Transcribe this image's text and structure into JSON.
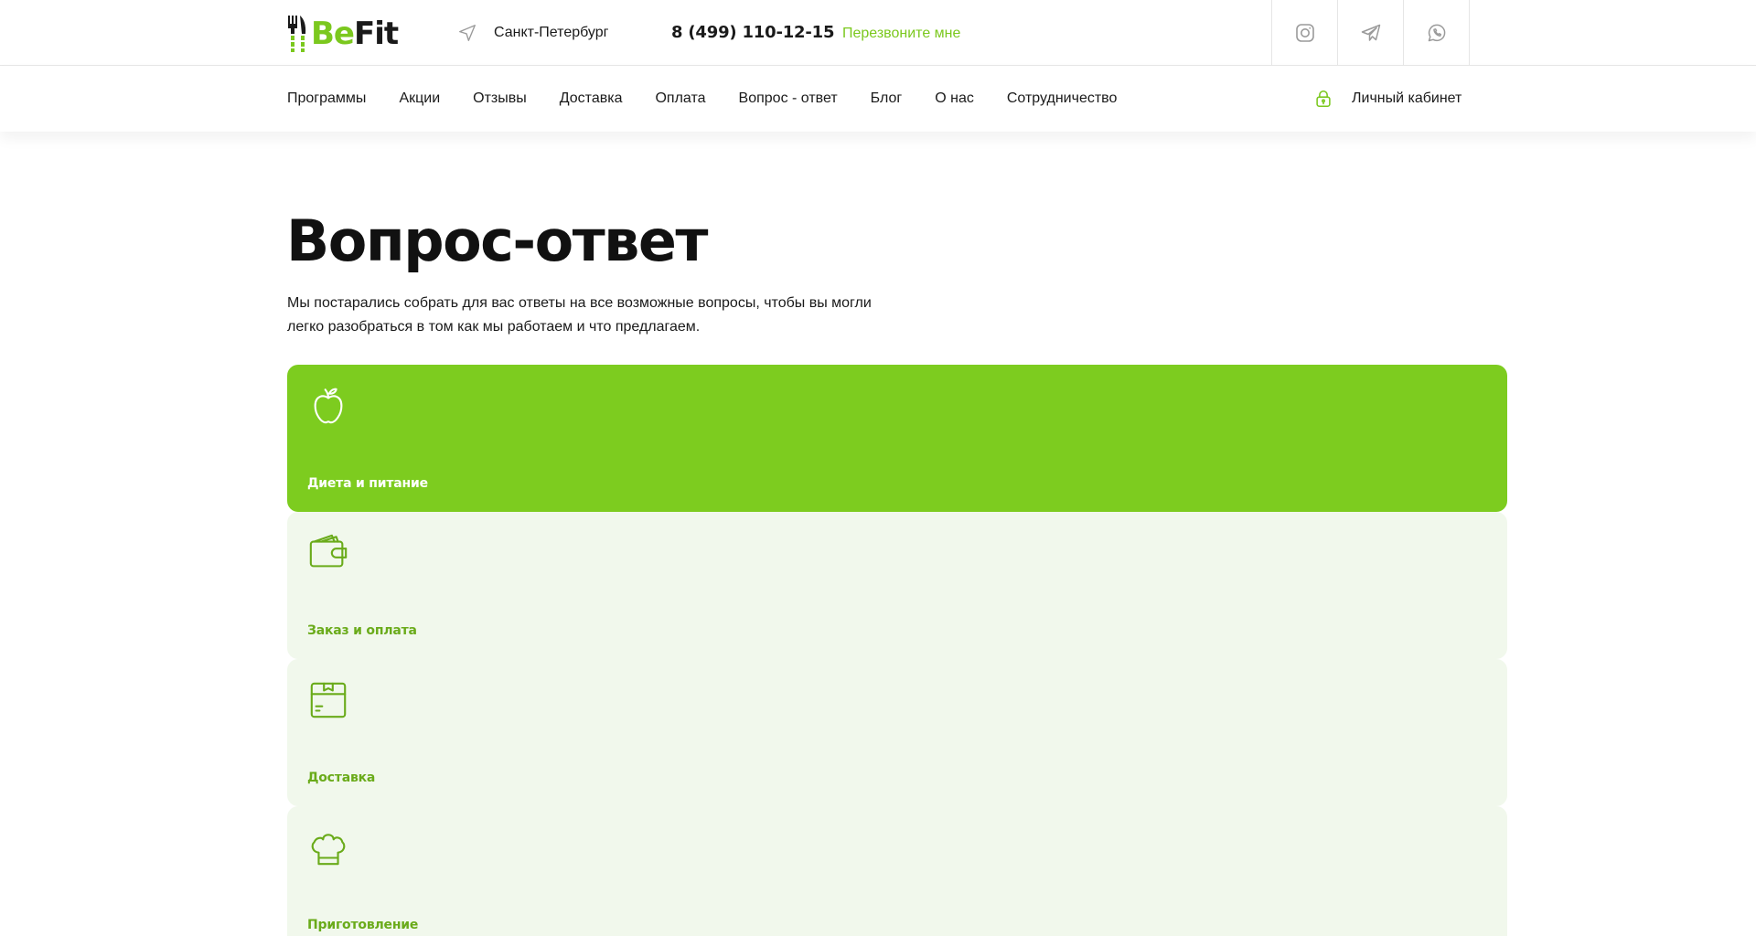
{
  "header": {
    "logo": {
      "part1": "Be",
      "part2": "Fit"
    },
    "city": "Санкт-Петербург",
    "phone": "8 (499) 110-12-15",
    "callback": "Перезвоните мне",
    "socials": [
      {
        "name": "instagram",
        "icon": "instagram-icon"
      },
      {
        "name": "telegram",
        "icon": "telegram-icon"
      },
      {
        "name": "whatsapp",
        "icon": "whatsapp-icon"
      }
    ]
  },
  "nav": {
    "items": [
      "Программы",
      "Акции",
      "Отзывы",
      "Доставка",
      "Оплата",
      "Вопрос - ответ",
      "Блог",
      "О нас",
      "Сотрудничество"
    ],
    "cabinet": "Личный кабинет"
  },
  "main": {
    "title": "Вопрос-ответ",
    "description": "Мы постарались собрать для вас ответы на все возможные вопросы, чтобы вы могли легко разобраться в том как мы работаем и что предлагаем.",
    "categories": [
      {
        "label": "Диета и питание",
        "icon": "apple-icon",
        "active": true
      },
      {
        "label": "Заказ и оплата",
        "icon": "wallet-icon",
        "active": false
      },
      {
        "label": "Доставка",
        "icon": "box-icon",
        "active": false
      },
      {
        "label": "Приготовление",
        "icon": "chef-hat-icon",
        "active": false
      }
    ]
  },
  "colors": {
    "accent": "#7bc81e",
    "accent_card": "#7dcc1f",
    "card_bg": "#f1f8ec",
    "card_label": "#6aab1a",
    "text": "#1a1a1a",
    "icon_gray": "#9a9a9a"
  }
}
